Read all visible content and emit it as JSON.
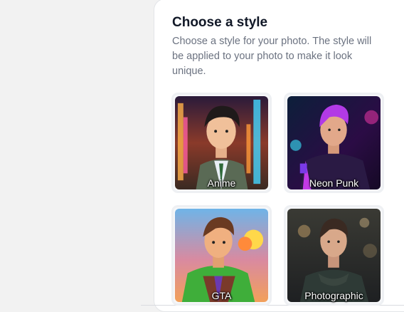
{
  "panel": {
    "title": "Choose a style",
    "description": "Choose a style for your photo. The style will be applied to your photo to make it look unique."
  },
  "styles": [
    {
      "label": "Anime"
    },
    {
      "label": "Neon Punk"
    },
    {
      "label": "GTA"
    },
    {
      "label": "Photographic"
    }
  ],
  "colors": {
    "background": "#f2f2f2",
    "panel": "#ffffff",
    "title": "#111827",
    "description": "#6b7280",
    "card_border": "#eef0f3"
  }
}
